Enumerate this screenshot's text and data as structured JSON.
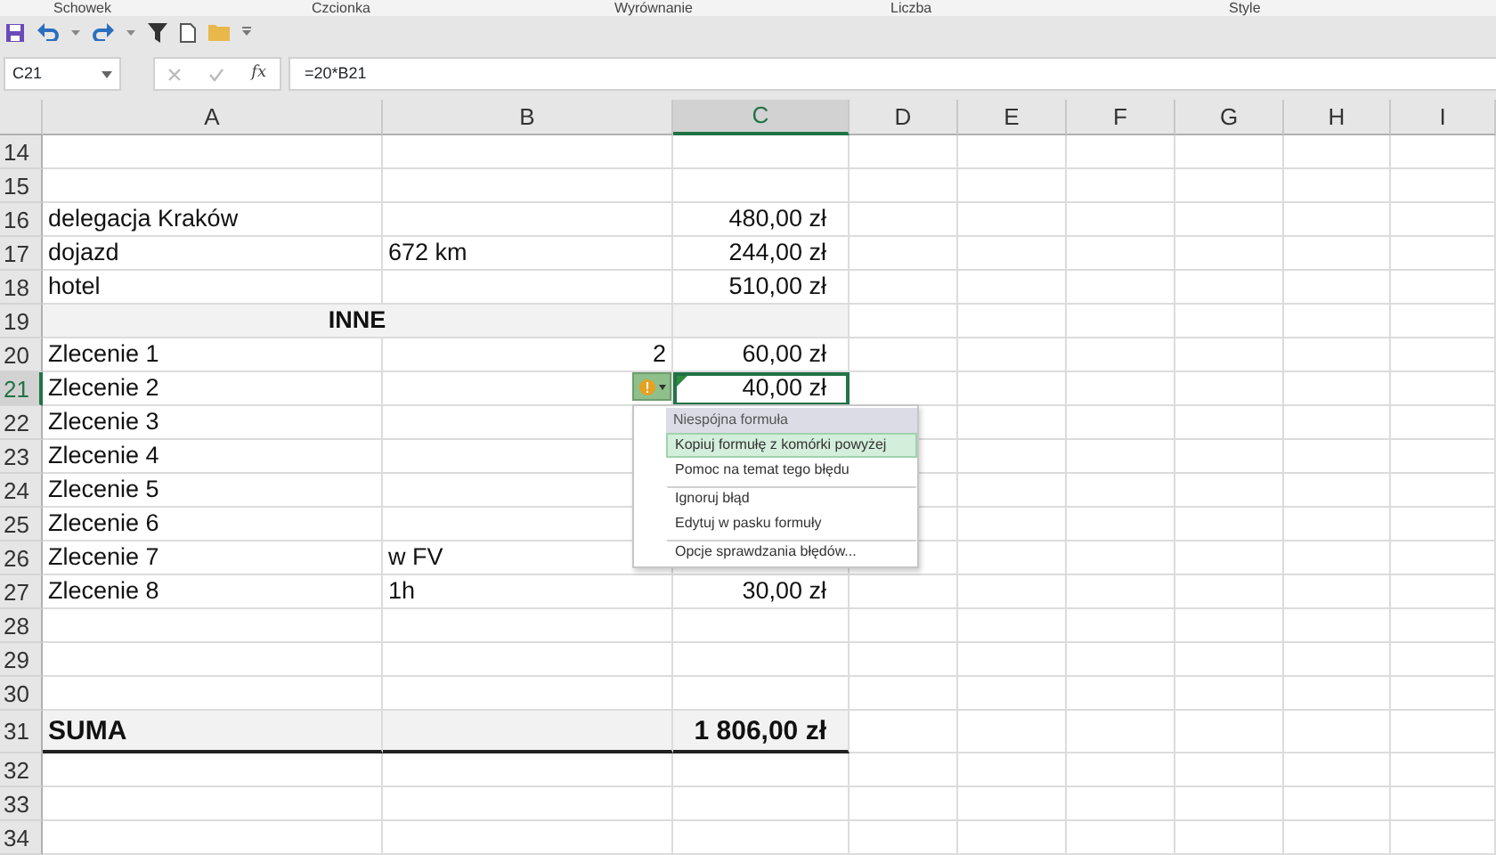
{
  "ribbon_groups": [
    "Schowek",
    "Czcionka",
    "Wyrównanie",
    "Liczba",
    "Style"
  ],
  "formula_bar": {
    "name_box": "C21",
    "function_label": "fx",
    "formula": "=20*B21"
  },
  "columns": [
    {
      "label": "A",
      "selected": false
    },
    {
      "label": "B",
      "selected": false
    },
    {
      "label": "C",
      "selected": true
    },
    {
      "label": "D",
      "selected": false
    },
    {
      "label": "E",
      "selected": false
    },
    {
      "label": "F",
      "selected": false
    },
    {
      "label": "G",
      "selected": false
    },
    {
      "label": "H",
      "selected": false
    },
    {
      "label": "I",
      "selected": false
    }
  ],
  "rows": [
    {
      "number": "14",
      "kind": "plain",
      "selected": false
    },
    {
      "number": "15",
      "kind": "plain",
      "selected": false
    },
    {
      "number": "16",
      "kind": "plain",
      "selected": false,
      "a": "delegacja Kraków",
      "c": "480,00 zł"
    },
    {
      "number": "17",
      "kind": "plain",
      "selected": false,
      "a": "dojazd",
      "b": "672 km",
      "c": "244,00 zł"
    },
    {
      "number": "18",
      "kind": "plain",
      "selected": false,
      "a": "hotel",
      "c": "510,00 zł"
    },
    {
      "number": "19",
      "kind": "section",
      "selected": false,
      "a": "INNE"
    },
    {
      "number": "20",
      "kind": "plain",
      "selected": false,
      "a": "Zlecenie 1",
      "b": "2",
      "c": "60,00 zł"
    },
    {
      "number": "21",
      "kind": "plain",
      "selected": true,
      "a": "Zlecenie 2",
      "c": "40,00 zł"
    },
    {
      "number": "22",
      "kind": "plain",
      "selected": false,
      "a": "Zlecenie 3"
    },
    {
      "number": "23",
      "kind": "plain",
      "selected": false,
      "a": "Zlecenie 4"
    },
    {
      "number": "24",
      "kind": "plain",
      "selected": false,
      "a": "Zlecenie 5"
    },
    {
      "number": "25",
      "kind": "plain",
      "selected": false,
      "a": "Zlecenie 6"
    },
    {
      "number": "26",
      "kind": "plain",
      "selected": false,
      "a": "Zlecenie 7",
      "b": "w FV"
    },
    {
      "number": "27",
      "kind": "plain",
      "selected": false,
      "a": "Zlecenie 8",
      "b": "1h",
      "c": "30,00 zł"
    },
    {
      "number": "28",
      "kind": "plain",
      "selected": false
    },
    {
      "number": "29",
      "kind": "plain",
      "selected": false
    },
    {
      "number": "30",
      "kind": "plain",
      "selected": false
    },
    {
      "number": "31",
      "kind": "total",
      "selected": false,
      "a": "SUMA",
      "c": "1 806,00 zł"
    },
    {
      "number": "32",
      "kind": "plain",
      "selected": false
    },
    {
      "number": "33",
      "kind": "plain",
      "selected": false
    },
    {
      "number": "34",
      "kind": "plain",
      "selected": false
    }
  ],
  "error_menu": {
    "title": "Niespójna formuła",
    "items": [
      {
        "label": "Kopiuj formułę z komórki powyżej",
        "selected": true,
        "separator_before": false
      },
      {
        "label": "Pomoc na temat tego błędu",
        "selected": false,
        "separator_before": false
      },
      {
        "label": "Ignoruj błąd",
        "selected": false,
        "separator_before": true
      },
      {
        "label": "Edytuj w pasku formuły",
        "selected": false,
        "separator_before": false
      },
      {
        "label": "Opcje sprawdzania błędów...",
        "selected": false,
        "separator_before": true
      }
    ]
  }
}
